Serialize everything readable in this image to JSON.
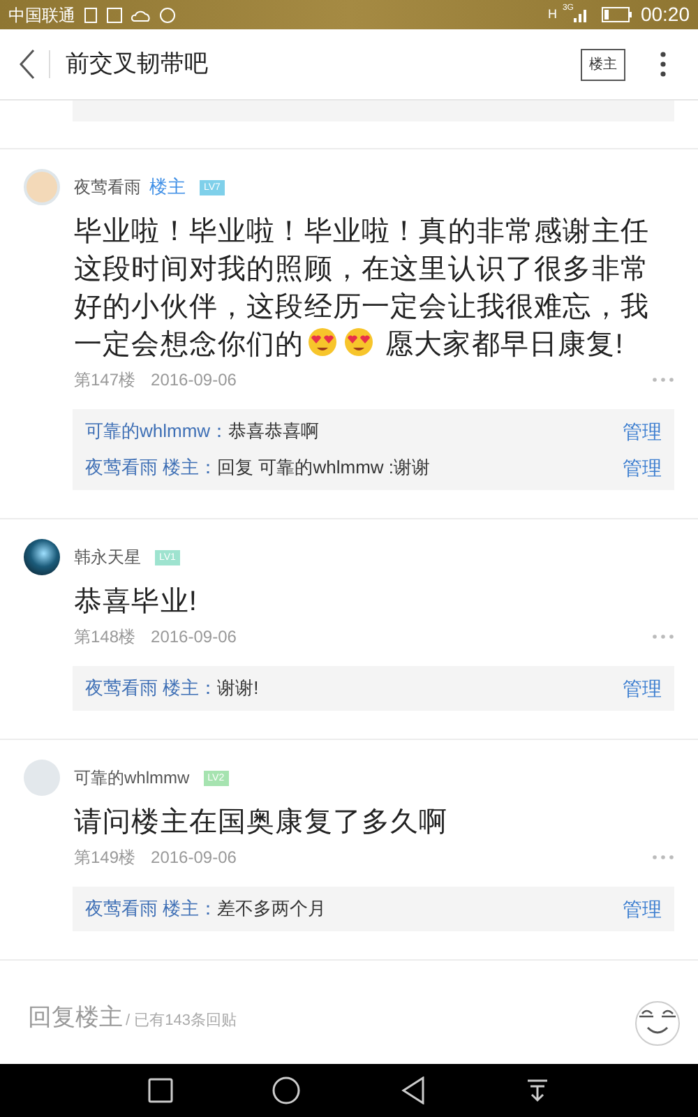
{
  "status_bar": {
    "carrier": "中国联通",
    "network_h": "H",
    "network_3g": "3G",
    "time": "00:20"
  },
  "header": {
    "title": "前交叉韧带吧",
    "op_button": "楼主"
  },
  "posts": [
    {
      "avatar": {
        "kind": "bear"
      },
      "author": "夜莺看雨",
      "op_label": "楼主",
      "level": "LV7",
      "color": "#7fd0ea",
      "body": [
        {
          "kind": "text",
          "text": "毕业啦！毕业啦！毕业啦！真的非常感谢主任这段时间对我的照顾，在这里认识了很多非常好的小伙伴，这段经历一定会让我很难忘，我一定会想念你们的"
        },
        {
          "kind": "emoji"
        },
        {
          "kind": "emoji"
        },
        {
          "kind": "text",
          "text": " 愿大家都早日康复!"
        }
      ],
      "floor": "第147楼",
      "date": "2016-09-06",
      "replies": [
        {
          "author": "可靠的whlmmw：",
          "text": "恭喜恭喜啊",
          "action": "管理"
        },
        {
          "author": "夜莺看雨 楼主：",
          "text": "回复 可靠的whlmmw :谢谢",
          "action": "管理"
        }
      ]
    },
    {
      "avatar": {
        "kind": "space"
      },
      "author": "韩永天星",
      "level": "LV1",
      "color": "#9ee3cf",
      "body": [
        {
          "kind": "text",
          "text": "恭喜毕业!"
        }
      ],
      "floor": "第148楼",
      "date": "2016-09-06",
      "replies": [
        {
          "author": "夜莺看雨 楼主：",
          "text": "谢谢!",
          "action": "管理"
        }
      ]
    },
    {
      "avatar": {
        "kind": "default"
      },
      "author": "可靠的whlmmw",
      "level": "LV2",
      "color": "#a6e3b0",
      "body": [
        {
          "kind": "text",
          "text": "请问楼主在国奥康复了多久啊"
        }
      ],
      "floor": "第149楼",
      "date": "2016-09-06",
      "replies": [
        {
          "author": "夜莺看雨 楼主：",
          "text": "差不多两个月",
          "action": "管理"
        }
      ]
    }
  ],
  "reply_bar": {
    "placeholder": "回复楼主",
    "count": "/ 已有143条回贴"
  }
}
